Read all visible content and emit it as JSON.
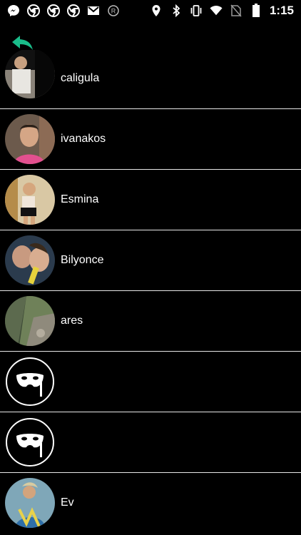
{
  "status_bar": {
    "time": "1:15",
    "left_icons": [
      "messenger-icon",
      "chrome-icon",
      "chrome-icon",
      "chrome-icon",
      "gmail-icon",
      "registered-icon"
    ],
    "right_icons": [
      "location-icon",
      "bluetooth-icon",
      "vibrate-icon",
      "wifi-icon",
      "no-sim-icon",
      "battery-icon"
    ]
  },
  "toolbar": {
    "back_icon": "reply-back-icon",
    "accent": "#1abc8a"
  },
  "users": [
    {
      "name": "caligula",
      "avatar": "photo"
    },
    {
      "name": "ivanakos",
      "avatar": "photo"
    },
    {
      "name": "Esmina",
      "avatar": "photo"
    },
    {
      "name": "Bilyonce",
      "avatar": "photo"
    },
    {
      "name": "ares",
      "avatar": "photo"
    },
    {
      "name": "",
      "avatar": "mask-icon"
    },
    {
      "name": "",
      "avatar": "mask-icon"
    },
    {
      "name": "Ev",
      "avatar": "photo"
    }
  ]
}
